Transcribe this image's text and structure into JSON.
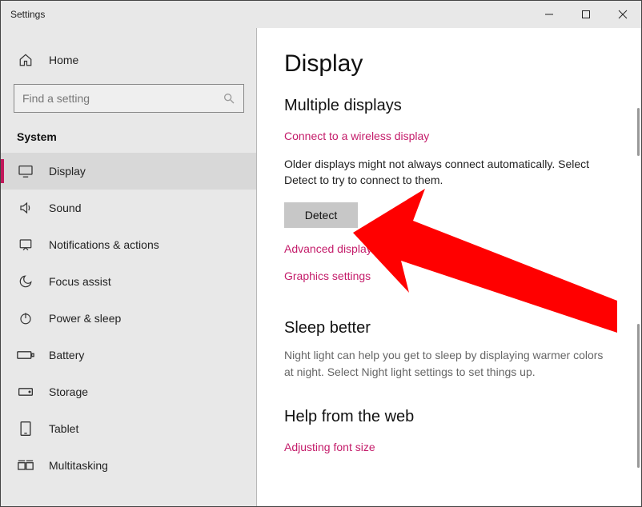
{
  "window": {
    "title": "Settings"
  },
  "sidebar": {
    "home": "Home",
    "search_placeholder": "Find a setting",
    "group": "System",
    "items": [
      {
        "label": "Display"
      },
      {
        "label": "Sound"
      },
      {
        "label": "Notifications & actions"
      },
      {
        "label": "Focus assist"
      },
      {
        "label": "Power & sleep"
      },
      {
        "label": "Battery"
      },
      {
        "label": "Storage"
      },
      {
        "label": "Tablet"
      },
      {
        "label": "Multitasking"
      }
    ]
  },
  "content": {
    "page_title": "Display",
    "multi_heading": "Multiple displays",
    "link_wireless": "Connect to a wireless display",
    "older_text": "Older displays might not always connect automatically. Select Detect to try to connect to them.",
    "detect": "Detect",
    "link_advanced": "Advanced display settings",
    "link_graphics": "Graphics settings",
    "sleep_heading": "Sleep better",
    "sleep_text": "Night light can help you get to sleep by displaying warmer colors at night. Select Night light settings to set things up.",
    "help_heading": "Help from the web",
    "link_font": "Adjusting font size"
  }
}
